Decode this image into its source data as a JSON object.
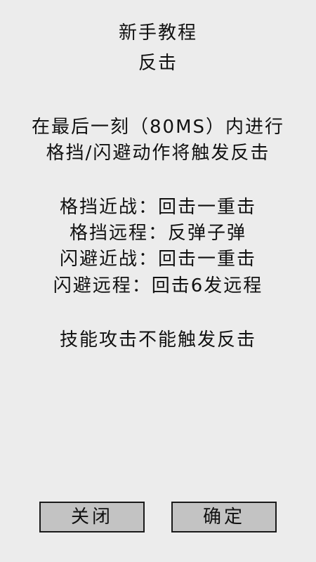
{
  "dialog": {
    "title": "新手教程",
    "subtitle": "反击",
    "description_lines": [
      "在最后一刻（80MS）内进行",
      "格挡/闪避动作将触发反击"
    ],
    "rules": [
      "格挡近战：回击一重击",
      "格挡远程：反弹子弹",
      "闪避近战：回击一重击",
      "闪避远程：回击6发远程"
    ],
    "note": "技能攻击不能触发反击"
  },
  "buttons": {
    "close_label": "关闭",
    "confirm_label": "确定"
  }
}
